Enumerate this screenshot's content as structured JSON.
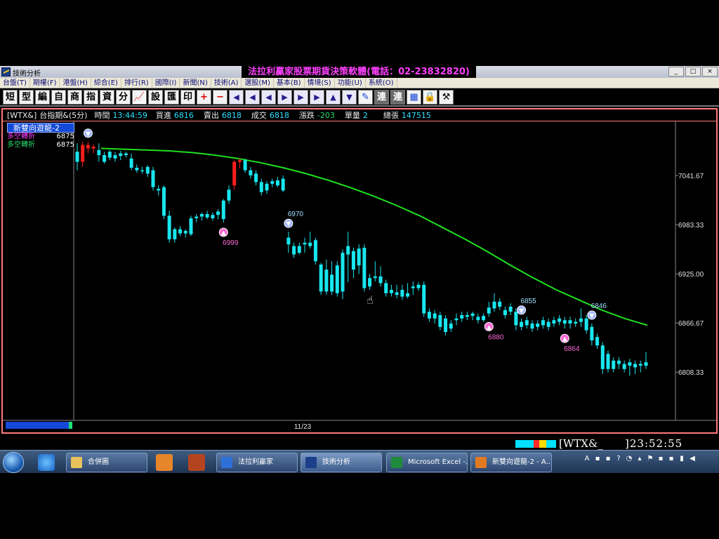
{
  "window": {
    "title": "技術分析",
    "banner": "法拉利贏家股票期貨決策軟體(電話：02-23832820)",
    "controls": [
      "_",
      "□",
      "×"
    ]
  },
  "menu": [
    "台盤(T)",
    "期權(F)",
    "港盤(H)",
    "綜合(E)",
    "排行(R)",
    "國際(I)",
    "新聞(N)",
    "技術(A)",
    "選股(M)",
    "基本(B)",
    "情境(S)",
    "功能(U)",
    "系統(O)"
  ],
  "toolbar": {
    "text_buttons": [
      "短",
      "型",
      "編",
      "自",
      "商",
      "指",
      "資",
      "分"
    ],
    "text_buttons2": [
      "設",
      "匯",
      "印"
    ],
    "connect_buttons": [
      "連",
      "連"
    ]
  },
  "info": {
    "symbol": "[WTX&]",
    "name": "台指期&(5分)",
    "time_label": "時間",
    "time_value": "13:44:59",
    "bid_label": "買進",
    "bid_value": "6816",
    "ask_label": "賣出",
    "ask_value": "6818",
    "trade_label": "成交",
    "trade_value": "6818",
    "change_label": "漲跌",
    "change_value": "-203",
    "vol_label": "單量",
    "vol_value": "2",
    "total_label": "總張",
    "total_value": "147515"
  },
  "indicator": {
    "title": "新雙向遊龍-2",
    "rows": [
      {
        "label": "多空轉折",
        "value": "6875",
        "color": "#ff40ff"
      },
      {
        "label": "多空轉折",
        "value": "6875",
        "color": "#29d96c"
      }
    ]
  },
  "chart_data": {
    "type": "candlestick",
    "title": "",
    "x_label": "11/23",
    "y_ticks": [
      7041.67,
      6983.33,
      6925.0,
      6866.67,
      6808.33
    ],
    "ylim": [
      6751,
      7106
    ],
    "candles": [
      {
        "o": 7070,
        "h": 7080,
        "l": 7048,
        "c": 7058,
        "color": "cyan"
      },
      {
        "o": 7058,
        "h": 7082,
        "l": 7052,
        "c": 7078,
        "color": "red"
      },
      {
        "o": 7078,
        "h": 7082,
        "l": 7068,
        "c": 7074,
        "color": "red"
      },
      {
        "o": 7074,
        "h": 7079,
        "l": 7068,
        "c": 7076,
        "color": "red"
      },
      {
        "o": 7072,
        "h": 7080,
        "l": 7058,
        "c": 7066,
        "color": "cyan"
      },
      {
        "o": 7066,
        "h": 7070,
        "l": 7056,
        "c": 7058,
        "color": "cyan"
      },
      {
        "o": 7070,
        "h": 7072,
        "l": 7060,
        "c": 7063,
        "color": "cyan"
      },
      {
        "o": 7066,
        "h": 7070,
        "l": 7058,
        "c": 7062,
        "color": "cyan"
      },
      {
        "o": 7065,
        "h": 7071,
        "l": 7060,
        "c": 7068,
        "color": "cyan"
      },
      {
        "o": 7068,
        "h": 7070,
        "l": 7063,
        "c": 7066,
        "color": "cyan"
      },
      {
        "o": 7062,
        "h": 7068,
        "l": 7048,
        "c": 7051,
        "color": "cyan"
      },
      {
        "o": 7051,
        "h": 7055,
        "l": 7045,
        "c": 7048,
        "color": "cyan"
      },
      {
        "o": 7048,
        "h": 7052,
        "l": 7044,
        "c": 7047,
        "color": "cyan"
      },
      {
        "o": 7052,
        "h": 7054,
        "l": 7040,
        "c": 7044,
        "color": "cyan"
      },
      {
        "o": 7048,
        "h": 7052,
        "l": 7024,
        "c": 7028,
        "color": "cyan"
      },
      {
        "o": 7024,
        "h": 7030,
        "l": 7018,
        "c": 7026,
        "color": "cyan"
      },
      {
        "o": 7028,
        "h": 7030,
        "l": 6990,
        "c": 6994,
        "color": "cyan"
      },
      {
        "o": 6994,
        "h": 7000,
        "l": 6962,
        "c": 6966,
        "color": "cyan"
      },
      {
        "o": 6966,
        "h": 6980,
        "l": 6962,
        "c": 6978,
        "color": "cyan"
      },
      {
        "o": 6978,
        "h": 6982,
        "l": 6970,
        "c": 6973,
        "color": "cyan"
      },
      {
        "o": 6973,
        "h": 6978,
        "l": 6968,
        "c": 6976,
        "color": "cyan"
      },
      {
        "o": 6972,
        "h": 6994,
        "l": 6970,
        "c": 6991,
        "color": "cyan"
      },
      {
        "o": 6991,
        "h": 6996,
        "l": 6986,
        "c": 6993,
        "color": "cyan"
      },
      {
        "o": 6993,
        "h": 6998,
        "l": 6988,
        "c": 6996,
        "color": "cyan"
      },
      {
        "o": 6996,
        "h": 7000,
        "l": 6990,
        "c": 6992,
        "color": "cyan"
      },
      {
        "o": 6995,
        "h": 6998,
        "l": 6988,
        "c": 6991,
        "color": "cyan"
      },
      {
        "o": 6995,
        "h": 7002,
        "l": 6990,
        "c": 6999,
        "color": "cyan"
      },
      {
        "o": 6990,
        "h": 7014,
        "l": 6986,
        "c": 7012,
        "color": "cyan"
      },
      {
        "o": 7012,
        "h": 7030,
        "l": 7008,
        "c": 7025,
        "color": "cyan"
      },
      {
        "o": 7030,
        "h": 7060,
        "l": 7025,
        "c": 7058,
        "color": "red"
      },
      {
        "o": 7058,
        "h": 7062,
        "l": 7050,
        "c": 7060,
        "color": "red"
      },
      {
        "o": 7060,
        "h": 7062,
        "l": 7045,
        "c": 7048,
        "color": "cyan"
      },
      {
        "o": 7048,
        "h": 7052,
        "l": 7038,
        "c": 7042,
        "color": "cyan"
      },
      {
        "o": 7044,
        "h": 7048,
        "l": 7030,
        "c": 7034,
        "color": "cyan"
      },
      {
        "o": 7034,
        "h": 7038,
        "l": 7018,
        "c": 7022,
        "color": "cyan"
      },
      {
        "o": 7032,
        "h": 7035,
        "l": 7020,
        "c": 7024,
        "color": "cyan"
      },
      {
        "o": 7035,
        "h": 7038,
        "l": 7028,
        "c": 7032,
        "color": "cyan"
      },
      {
        "o": 7036,
        "h": 7040,
        "l": 7028,
        "c": 7030,
        "color": "cyan"
      },
      {
        "o": 7038,
        "h": 7042,
        "l": 7022,
        "c": 7024,
        "color": "cyan"
      },
      {
        "o": 6968,
        "h": 6975,
        "l": 6950,
        "c": 6960,
        "color": "cyan"
      },
      {
        "o": 6958,
        "h": 6962,
        "l": 6944,
        "c": 6948,
        "color": "cyan"
      },
      {
        "o": 6958,
        "h": 6962,
        "l": 6948,
        "c": 6950,
        "color": "cyan"
      },
      {
        "o": 6960,
        "h": 6968,
        "l": 6950,
        "c": 6962,
        "color": "cyan"
      },
      {
        "o": 6962,
        "h": 6975,
        "l": 6955,
        "c": 6958,
        "color": "cyan"
      },
      {
        "o": 6965,
        "h": 6968,
        "l": 6936,
        "c": 6940,
        "color": "cyan"
      },
      {
        "o": 6936,
        "h": 6938,
        "l": 6900,
        "c": 6904,
        "color": "cyan"
      },
      {
        "o": 6930,
        "h": 6942,
        "l": 6900,
        "c": 6904,
        "color": "cyan"
      },
      {
        "o": 6924,
        "h": 6940,
        "l": 6900,
        "c": 6904,
        "color": "cyan"
      },
      {
        "o": 6935,
        "h": 6940,
        "l": 6898,
        "c": 6902,
        "color": "cyan"
      },
      {
        "o": 6950,
        "h": 6954,
        "l": 6895,
        "c": 6904,
        "color": "cyan"
      },
      {
        "o": 6958,
        "h": 6975,
        "l": 6915,
        "c": 6948,
        "color": "cyan"
      },
      {
        "o": 6952,
        "h": 6956,
        "l": 6920,
        "c": 6930,
        "color": "cyan"
      },
      {
        "o": 6955,
        "h": 6960,
        "l": 6925,
        "c": 6935,
        "color": "cyan"
      },
      {
        "o": 6956,
        "h": 6960,
        "l": 6904,
        "c": 6908,
        "color": "cyan"
      },
      {
        "o": 6920,
        "h": 6925,
        "l": 6906,
        "c": 6910,
        "color": "cyan"
      },
      {
        "o": 6922,
        "h": 6940,
        "l": 6916,
        "c": 6920,
        "color": "cyan"
      },
      {
        "o": 6922,
        "h": 6934,
        "l": 6910,
        "c": 6914,
        "color": "cyan"
      },
      {
        "o": 6914,
        "h": 6918,
        "l": 6898,
        "c": 6902,
        "color": "cyan"
      },
      {
        "o": 6906,
        "h": 6912,
        "l": 6898,
        "c": 6902,
        "color": "cyan"
      },
      {
        "o": 6903,
        "h": 6912,
        "l": 6896,
        "c": 6900,
        "color": "cyan"
      },
      {
        "o": 6906,
        "h": 6912,
        "l": 6894,
        "c": 6898,
        "color": "cyan"
      },
      {
        "o": 6902,
        "h": 6914,
        "l": 6896,
        "c": 6898,
        "color": "cyan"
      },
      {
        "o": 6908,
        "h": 6916,
        "l": 6900,
        "c": 6910,
        "color": "cyan"
      },
      {
        "o": 6912,
        "h": 6915,
        "l": 6905,
        "c": 6908,
        "color": "cyan"
      },
      {
        "o": 6912,
        "h": 6916,
        "l": 6874,
        "c": 6878,
        "color": "cyan"
      },
      {
        "o": 6880,
        "h": 6884,
        "l": 6868,
        "c": 6872,
        "color": "cyan"
      },
      {
        "o": 6878,
        "h": 6882,
        "l": 6866,
        "c": 6872,
        "color": "cyan"
      },
      {
        "o": 6876,
        "h": 6880,
        "l": 6858,
        "c": 6862,
        "color": "cyan"
      },
      {
        "o": 6872,
        "h": 6876,
        "l": 6852,
        "c": 6856,
        "color": "cyan"
      },
      {
        "o": 6866,
        "h": 6870,
        "l": 6856,
        "c": 6860,
        "color": "cyan"
      },
      {
        "o": 6872,
        "h": 6878,
        "l": 6864,
        "c": 6870,
        "color": "cyan"
      },
      {
        "o": 6876,
        "h": 6880,
        "l": 6868,
        "c": 6872,
        "color": "cyan"
      },
      {
        "o": 6876,
        "h": 6880,
        "l": 6870,
        "c": 6874,
        "color": "cyan"
      },
      {
        "o": 6875,
        "h": 6880,
        "l": 6870,
        "c": 6878,
        "color": "cyan"
      },
      {
        "o": 6874,
        "h": 6878,
        "l": 6866,
        "c": 6870,
        "color": "cyan"
      },
      {
        "o": 6875,
        "h": 6878,
        "l": 6868,
        "c": 6870,
        "color": "cyan"
      },
      {
        "o": 6885,
        "h": 6892,
        "l": 6874,
        "c": 6878,
        "color": "cyan"
      },
      {
        "o": 6892,
        "h": 6902,
        "l": 6880,
        "c": 6884,
        "color": "cyan"
      },
      {
        "o": 6892,
        "h": 6896,
        "l": 6882,
        "c": 6886,
        "color": "cyan"
      },
      {
        "o": 6882,
        "h": 6886,
        "l": 6872,
        "c": 6876,
        "color": "cyan"
      },
      {
        "o": 6886,
        "h": 6890,
        "l": 6876,
        "c": 6880,
        "color": "cyan"
      },
      {
        "o": 6880,
        "h": 6884,
        "l": 6858,
        "c": 6864,
        "color": "cyan"
      },
      {
        "o": 6868,
        "h": 6872,
        "l": 6858,
        "c": 6862,
        "color": "cyan"
      },
      {
        "o": 6870,
        "h": 6874,
        "l": 6860,
        "c": 6864,
        "color": "cyan"
      },
      {
        "o": 6866,
        "h": 6870,
        "l": 6856,
        "c": 6860,
        "color": "cyan"
      },
      {
        "o": 6866,
        "h": 6870,
        "l": 6858,
        "c": 6862,
        "color": "cyan"
      },
      {
        "o": 6870,
        "h": 6874,
        "l": 6860,
        "c": 6864,
        "color": "cyan"
      },
      {
        "o": 6868,
        "h": 6872,
        "l": 6858,
        "c": 6862,
        "color": "cyan"
      },
      {
        "o": 6870,
        "h": 6874,
        "l": 6862,
        "c": 6866,
        "color": "cyan"
      },
      {
        "o": 6872,
        "h": 6876,
        "l": 6864,
        "c": 6868,
        "color": "cyan"
      },
      {
        "o": 6870,
        "h": 6874,
        "l": 6860,
        "c": 6866,
        "color": "cyan"
      },
      {
        "o": 6870,
        "h": 6874,
        "l": 6860,
        "c": 6866,
        "color": "cyan"
      },
      {
        "o": 6868,
        "h": 6872,
        "l": 6862,
        "c": 6866,
        "color": "cyan"
      },
      {
        "o": 6872,
        "h": 6884,
        "l": 6862,
        "c": 6868,
        "color": "cyan"
      },
      {
        "o": 6872,
        "h": 6876,
        "l": 6854,
        "c": 6858,
        "color": "cyan"
      },
      {
        "o": 6862,
        "h": 6866,
        "l": 6840,
        "c": 6846,
        "color": "cyan"
      },
      {
        "o": 6850,
        "h": 6854,
        "l": 6836,
        "c": 6840,
        "color": "cyan"
      },
      {
        "o": 6840,
        "h": 6844,
        "l": 6806,
        "c": 6812,
        "color": "cyan"
      },
      {
        "o": 6830,
        "h": 6834,
        "l": 6808,
        "c": 6812,
        "color": "cyan"
      },
      {
        "o": 6822,
        "h": 6826,
        "l": 6808,
        "c": 6812,
        "color": "cyan"
      },
      {
        "o": 6822,
        "h": 6826,
        "l": 6812,
        "c": 6818,
        "color": "cyan"
      },
      {
        "o": 6818,
        "h": 6822,
        "l": 6808,
        "c": 6812,
        "color": "cyan"
      },
      {
        "o": 6820,
        "h": 6824,
        "l": 6804,
        "c": 6816,
        "color": "cyan"
      },
      {
        "o": 6818,
        "h": 6822,
        "l": 6806,
        "c": 6814,
        "color": "cyan"
      },
      {
        "o": 6816,
        "h": 6822,
        "l": 6808,
        "c": 6818,
        "color": "cyan"
      },
      {
        "o": 6820,
        "h": 6832,
        "l": 6812,
        "c": 6816,
        "color": "cyan"
      }
    ],
    "ma": [
      7074,
      7073,
      7072,
      7071,
      7069,
      7066,
      7062,
      7057,
      7051,
      7044,
      7036,
      7027,
      7017,
      7006,
      6994,
      6980,
      6966,
      6951,
      6935,
      6920,
      6906,
      6894,
      6882,
      6872,
      6864
    ],
    "signals": [
      {
        "i": 2,
        "side": "sell",
        "label": ""
      },
      {
        "i": 27,
        "side": "buy",
        "label": "6999"
      },
      {
        "i": 39,
        "side": "sell",
        "label": "6970"
      },
      {
        "i": 76,
        "side": "buy",
        "label": "6880"
      },
      {
        "i": 82,
        "side": "sell",
        "label": "6855"
      },
      {
        "i": 90,
        "side": "buy",
        "label": "6864"
      },
      {
        "i": 95,
        "side": "sell",
        "label": "6846"
      }
    ]
  },
  "status": {
    "symbol": "[WTX&_",
    "clock": "]23:52:55",
    "colors": [
      "#00e0ff",
      "#ff2a2a",
      "#ffd800",
      "#00e0ff"
    ]
  },
  "taskbar": {
    "items": [
      {
        "label": "合併圖",
        "icon_color": "#e8c25a"
      },
      {
        "label": "法拉利贏家",
        "icon_color": "#2f6fd8"
      },
      {
        "label": "技術分析",
        "icon_color": "#1c3f8c"
      },
      {
        "label": "Microsoft Excel -...",
        "icon_color": "#1f8a3a"
      },
      {
        "label": "新雙向遊龍-2 - A...",
        "icon_color": "#e07a22"
      }
    ],
    "tray": [
      "A",
      "▪",
      "▪",
      "?",
      "◔",
      "▴",
      "⚑",
      "▪",
      "▪",
      "▮",
      "◀"
    ]
  }
}
